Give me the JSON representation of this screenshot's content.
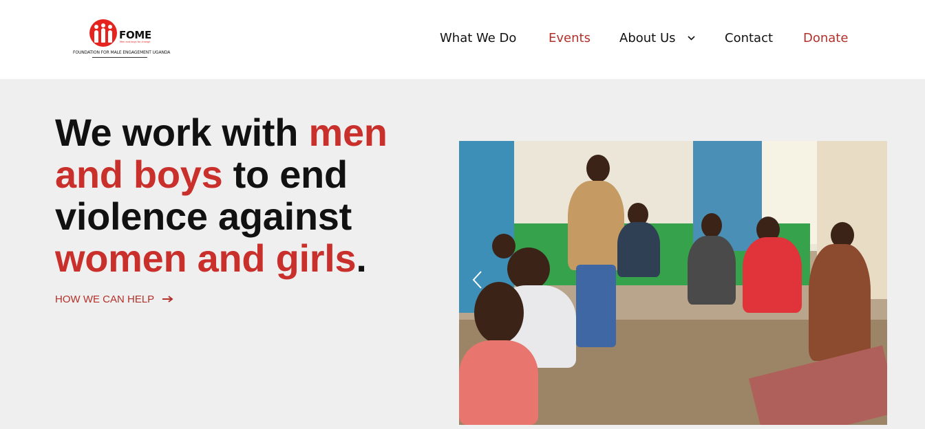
{
  "header": {
    "logo": {
      "name": "FOME",
      "tagline": "Men and boys for change",
      "full_name": "FOUNDATION FOR MALE ENGAGEMENT UGANDA"
    },
    "nav": [
      {
        "label": "What We Do",
        "accent": false
      },
      {
        "label": "Events",
        "accent": true
      },
      {
        "label": "About Us",
        "accent": false,
        "has_dropdown": true
      },
      {
        "label": "Contact",
        "accent": false
      },
      {
        "label": "Donate",
        "accent": true
      }
    ]
  },
  "hero": {
    "title_parts": {
      "p1": "We work with ",
      "p2": "men and boys",
      "p3": " to end violence against ",
      "p4": "women and girls",
      "p5": "."
    },
    "cta_label": "HOW WE CAN HELP",
    "cta_icon": "arrow-right-icon"
  },
  "slider": {
    "prev_icon": "chevron-left-icon"
  },
  "colors": {
    "accent": "#c9302c",
    "nav_accent": "#b3302a",
    "logo_red": "#e52420",
    "background": "#efefef"
  }
}
